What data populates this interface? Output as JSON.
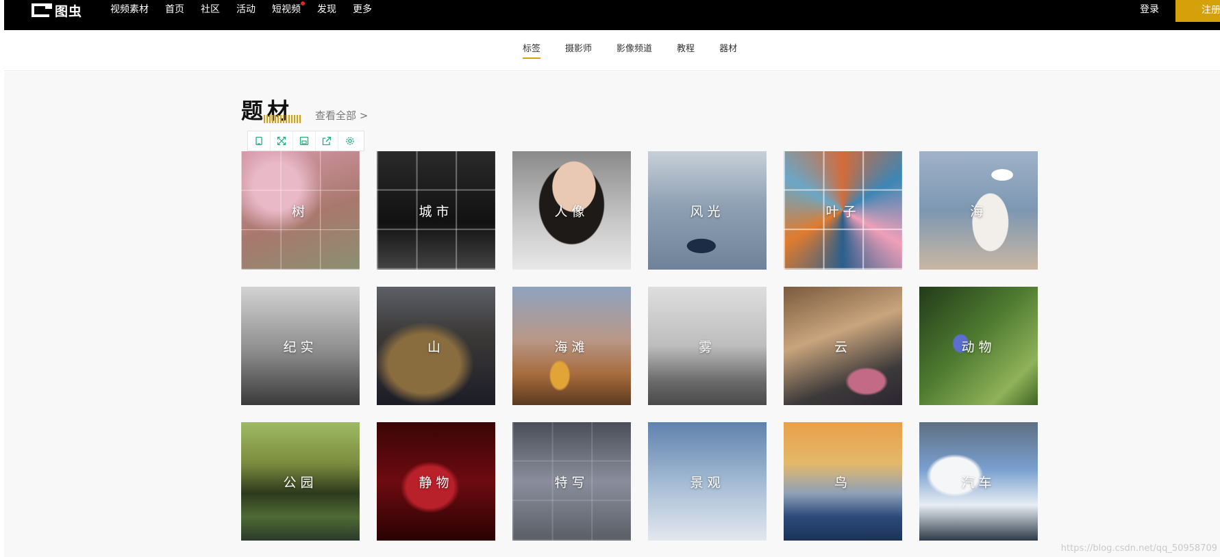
{
  "header": {
    "logo_text": "图虫",
    "nav": [
      {
        "label": "视频素材",
        "dot": false
      },
      {
        "label": "首页",
        "dot": false
      },
      {
        "label": "社区",
        "dot": false
      },
      {
        "label": "活动",
        "dot": false
      },
      {
        "label": "短视频",
        "dot": true
      },
      {
        "label": "发现",
        "dot": false
      },
      {
        "label": "更多",
        "dot": false
      }
    ],
    "login_label": "登录",
    "register_label": "注册"
  },
  "subnav": {
    "tabs": [
      "标签",
      "摄影师",
      "影像频道",
      "教程",
      "器材"
    ],
    "active_tab": "标签"
  },
  "section": {
    "title": "题材",
    "view_all": "查看全部 >"
  },
  "toolbar": {
    "icons": [
      "bookmark-icon",
      "fullscreen-icon",
      "save-icon",
      "share-icon",
      "settings-icon"
    ]
  },
  "tags": [
    "树",
    "城市",
    "人像",
    "风光",
    "叶子",
    "海",
    "纪实",
    "山",
    "海滩",
    "雾",
    "云",
    "动物",
    "公园",
    "静物",
    "特写",
    "景观",
    "鸟",
    "汽车"
  ],
  "watermark": "https://blog.csdn.net/qq_50958709",
  "colors": {
    "accent": "#d4a10b",
    "topbar": "#000000",
    "notification_dot": "#e1251b"
  }
}
